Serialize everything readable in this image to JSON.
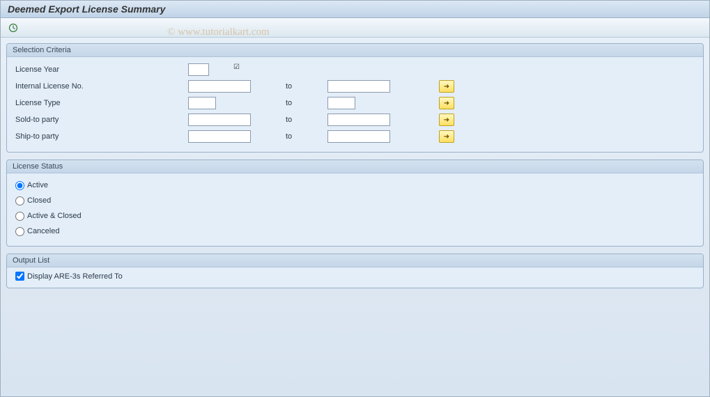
{
  "title": "Deemed Export License Summary",
  "watermark": "© www.tutorialkart.com",
  "toolbar": {
    "execute_icon": "⊕"
  },
  "groups": {
    "selection": {
      "title": "Selection Criteria",
      "fields": {
        "license_year": {
          "label": "License Year",
          "value": ""
        },
        "internal_no": {
          "label": "Internal License No.",
          "from": "",
          "to_label": "to",
          "to": ""
        },
        "license_type": {
          "label": "License Type",
          "from": "",
          "to_label": "to",
          "to": ""
        },
        "sold_to": {
          "label": "Sold-to party",
          "from": "",
          "to_label": "to",
          "to": ""
        },
        "ship_to": {
          "label": "Ship-to party",
          "from": "",
          "to_label": "to",
          "to": ""
        }
      }
    },
    "status": {
      "title": "License Status",
      "options": {
        "active": "Active",
        "closed": "Closed",
        "active_closed": "Active & Closed",
        "canceled": "Canceled"
      },
      "selected": "active"
    },
    "output": {
      "title": "Output List",
      "display_are3": {
        "label": "Display ARE-3s Referred To",
        "checked": true
      }
    }
  }
}
